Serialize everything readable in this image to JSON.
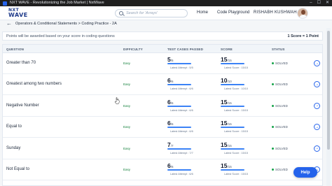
{
  "window": {
    "title": "NXT WAVE - Revolutionizing the Job Market | NxtWave",
    "minimize_glyph": "–",
    "maximize_glyph": "☐",
    "close_glyph": "✕"
  },
  "header": {
    "logo_line1": "NXT",
    "logo_line2": "WAVE",
    "search_placeholder": "Search for 'Arrays'",
    "nav_home": "Home",
    "nav_playground": "Code Playground",
    "user_name": "RISHABH KUSHWAHA"
  },
  "breadcrumb": {
    "text": "Operators & Conditional Statements  >  Coding Practice - 2A"
  },
  "points": {
    "note": "Points will be awarded based on your score in coding questions",
    "score": "1 Score = 1 Point"
  },
  "table": {
    "headers": {
      "question": "QUESTION",
      "difficulty": "DIFFICULTY",
      "test_cases": "TEST CASES PASSED",
      "score": "SCORE",
      "status": "STATUS"
    },
    "rows": [
      {
        "question": "Greater than 70",
        "difficulty": "Easy",
        "tc": "5",
        "tc_total": "/5",
        "tc_fraction": 1.0,
        "tc_latest": "Latest Attempt : 5/5",
        "score": "15",
        "score_total": "/15",
        "score_fraction": 1.0,
        "score_latest": "Latest Score : 15/15",
        "status": "SOLVED"
      },
      {
        "question": "Greatest among two numbers",
        "difficulty": "Easy",
        "tc": "6",
        "tc_total": "/6",
        "tc_fraction": 1.0,
        "tc_latest": "Latest Attempt : 6/6",
        "score": "10",
        "score_total": "/10",
        "score_fraction": 1.0,
        "score_latest": "Latest Score : 10/10",
        "status": "SOLVED"
      },
      {
        "question": "Negative Number",
        "difficulty": "Easy",
        "tc": "6",
        "tc_total": "/6",
        "tc_fraction": 1.0,
        "tc_latest": "Latest Attempt : 6/6",
        "score": "15",
        "score_total": "/15",
        "score_fraction": 1.0,
        "score_latest": "Latest Score : 15/15",
        "status": "SOLVED"
      },
      {
        "question": "Equal to",
        "difficulty": "Easy",
        "tc": "6",
        "tc_total": "/6",
        "tc_fraction": 1.0,
        "tc_latest": "Latest Attempt : 6/6",
        "score": "15",
        "score_total": "/15",
        "score_fraction": 1.0,
        "score_latest": "Latest Score : 15/15",
        "status": "SOLVED"
      },
      {
        "question": "Sunday",
        "difficulty": "Easy",
        "tc": "7",
        "tc_total": "/7",
        "tc_fraction": 1.0,
        "tc_latest": "Latest Attempt : 7/7",
        "score": "15",
        "score_total": "/15",
        "score_fraction": 1.0,
        "score_latest": "Latest Score : 15/15",
        "status": "SOLVED"
      },
      {
        "question": "Not Equal to",
        "difficulty": "Easy",
        "tc": "6",
        "tc_total": "/6",
        "tc_fraction": 1.0,
        "tc_latest": "Latest Attempt : 6/6",
        "score": "15",
        "score_total": "/15",
        "score_fraction": 1.0,
        "score_latest": "Latest Score : 15/15",
        "status": "SOLVED"
      }
    ]
  },
  "help_label": "Help",
  "icons": {
    "back": "arrow-left-icon",
    "search": "search-icon",
    "open": "arrow-right-circle-icon",
    "streak": "streak-icon"
  },
  "colors": {
    "accent": "#2563eb",
    "easy": "#15803d",
    "solved_dot": "#16a34a",
    "progress": "#3b82f6"
  }
}
